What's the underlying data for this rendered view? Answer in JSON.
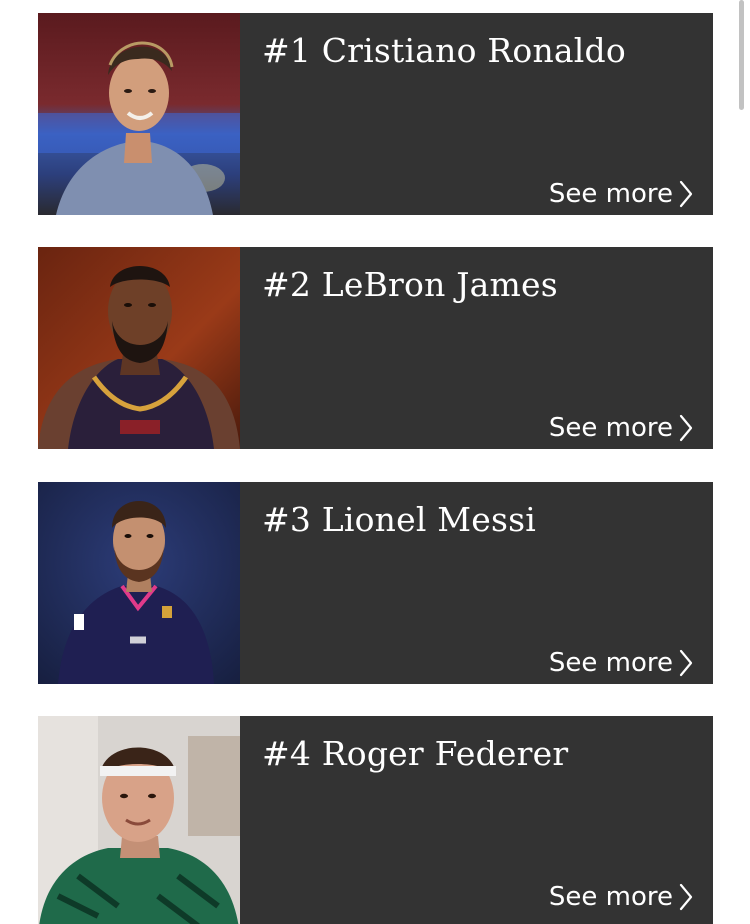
{
  "athletes": [
    {
      "title": "#1 Cristiano Ronaldo",
      "link_label": "See more",
      "photo_alt": "Cristiano Ronaldo"
    },
    {
      "title": "#2 LeBron James",
      "link_label": "See more",
      "photo_alt": "LeBron James"
    },
    {
      "title": "#3 Lionel Messi",
      "link_label": "See more",
      "photo_alt": "Lionel Messi"
    },
    {
      "title": "#4 Roger Federer",
      "link_label": "See more",
      "photo_alt": "Roger Federer"
    }
  ],
  "icons": {
    "chevron": "chevron-right-icon"
  },
  "colors": {
    "card_background": "#333333",
    "text": "#ffffff",
    "page_background": "#ffffff"
  }
}
